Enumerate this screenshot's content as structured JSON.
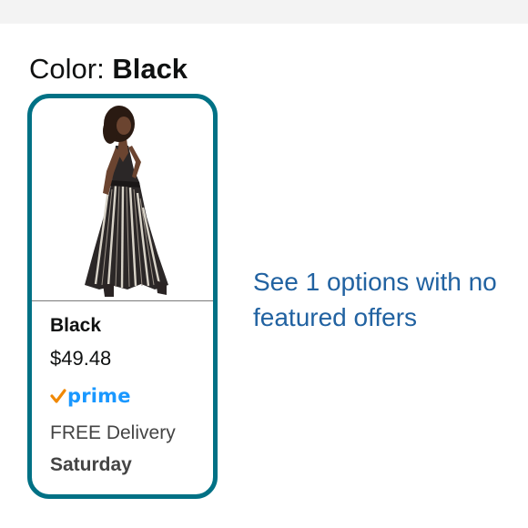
{
  "color_selector": {
    "label": "Color:",
    "selected_value": "Black"
  },
  "swatch": {
    "name": "Black",
    "price": "$49.48",
    "prime_label": "prime",
    "prime_icon": "prime-check-icon",
    "delivery_label": "FREE Delivery",
    "delivery_day": "Saturday",
    "border_color": "#007185"
  },
  "options_link": {
    "text": "See 1 options with no featured offers"
  },
  "colors": {
    "link": "#2162a1",
    "prime_blue": "#1a98ff",
    "prime_check": "#f08804"
  }
}
